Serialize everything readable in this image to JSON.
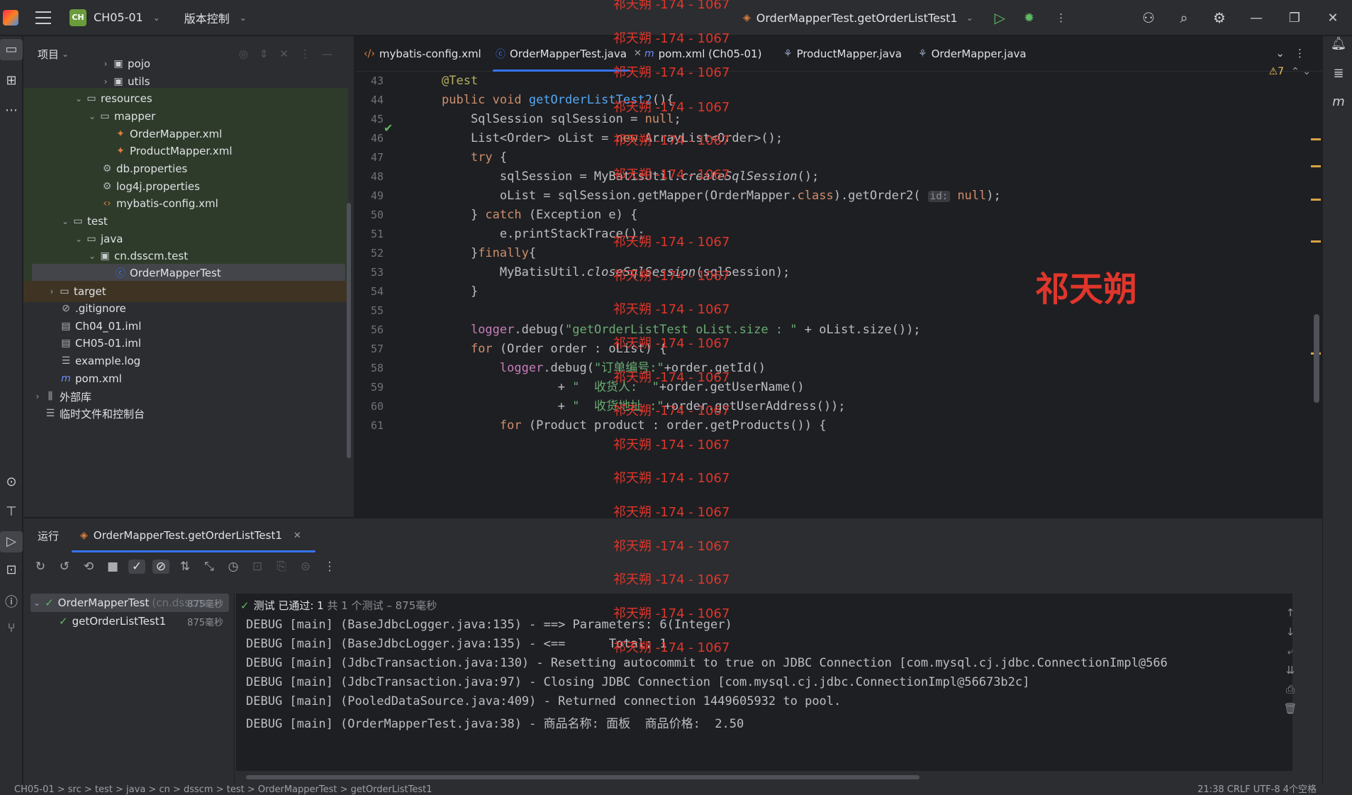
{
  "titlebar": {
    "project_badge": "CH",
    "project_name": "CH05-01",
    "vcs_label": "版本控制",
    "run_config": "OrderMapperTest.getOrderListTest1"
  },
  "project_panel": {
    "title": "项目",
    "items": [
      {
        "label": "pojo"
      },
      {
        "label": "utils"
      },
      {
        "label": "resources"
      },
      {
        "label": "mapper"
      },
      {
        "label": "OrderMapper.xml"
      },
      {
        "label": "ProductMapper.xml"
      },
      {
        "label": "db.properties"
      },
      {
        "label": "log4j.properties"
      },
      {
        "label": "mybatis-config.xml"
      },
      {
        "label": "test"
      },
      {
        "label": "java"
      },
      {
        "label": "cn.dsscm.test"
      },
      {
        "label": "OrderMapperTest"
      },
      {
        "label": "target"
      },
      {
        "label": ".gitignore"
      },
      {
        "label": "Ch04_01.iml"
      },
      {
        "label": "CH05-01.iml"
      },
      {
        "label": "example.log"
      },
      {
        "label": "pom.xml"
      },
      {
        "label": "外部库"
      },
      {
        "label": "临时文件和控制台"
      }
    ]
  },
  "editor": {
    "tabs": [
      {
        "label": "mybatis-config.xml"
      },
      {
        "label": "OrderMapperTest.java"
      },
      {
        "label": "pom.xml (Ch05-01)"
      },
      {
        "label": "ProductMapper.java"
      },
      {
        "label": "OrderMapper.java"
      }
    ],
    "warning_count": "7",
    "line_numbers": [
      "43",
      "44",
      "45",
      "46",
      "47",
      "48",
      "49",
      "50",
      "51",
      "52",
      "53",
      "54",
      "55",
      "56",
      "57",
      "58",
      "59",
      "60",
      "61"
    ]
  },
  "run_panel": {
    "tab_label": "运行",
    "config_label": "OrderMapperTest.getOrderListTest1",
    "tree": [
      {
        "label": "OrderMapperTest",
        "detail": "(cn.dsscm",
        "duration": "875毫秒"
      },
      {
        "label": "getOrderListTest1",
        "duration": "875毫秒"
      }
    ],
    "status": {
      "text": "测试 已通过: 1",
      "muted": "共 1 个测试 – 875毫秒"
    },
    "console_lines": [
      "DEBUG [main] (BaseJdbcLogger.java:135) - ==> Parameters: 6(Integer)",
      "DEBUG [main] (BaseJdbcLogger.java:135) - <==      Total: 1",
      "DEBUG [main] (JdbcTransaction.java:130) - Resetting autocommit to true on JDBC Connection [com.mysql.cj.jdbc.ConnectionImpl@566",
      "DEBUG [main] (JdbcTransaction.java:97) - Closing JDBC Connection [com.mysql.cj.jdbc.ConnectionImpl@56673b2c]",
      "DEBUG [main] (PooledDataSource.java:409) - Returned connection 1449605932 to pool.",
      "DEBUG [main] (OrderMapperTest.java:38) - 商品名称: 面板  商品价格:  2.50"
    ]
  },
  "watermark": {
    "small": "祁天朔 -174 - 1067",
    "big": "祁天朔"
  },
  "statusbar": {
    "left": "CH05-01 > src > test > java > cn > dsscm > test > OrderMapperTest > getOrderListTest1",
    "right": "21:38   CRLF   UTF-8   4个空格"
  }
}
